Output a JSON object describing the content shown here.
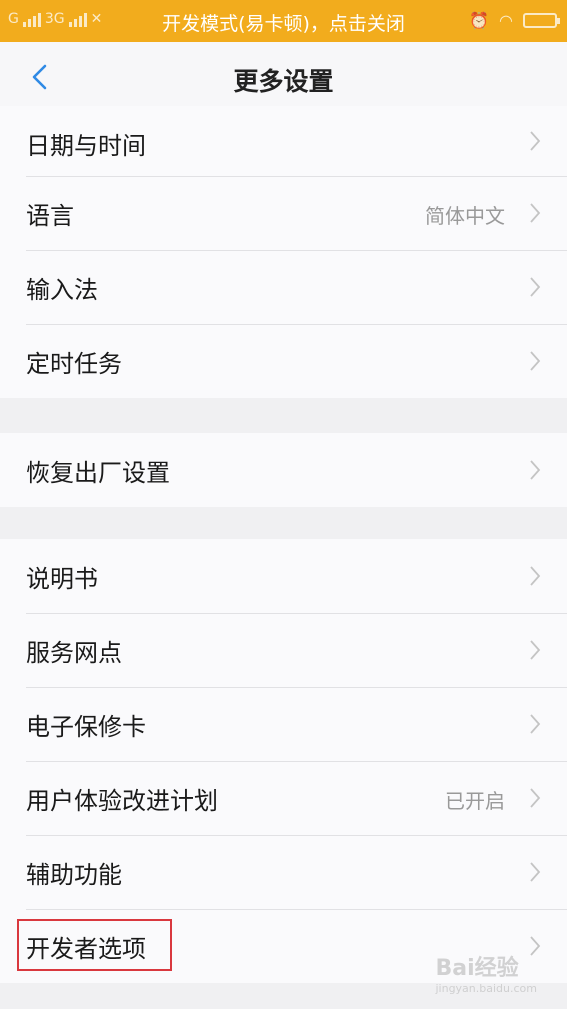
{
  "status_bar": {
    "left_text": "G",
    "network_label": "3G",
    "notice": "开发模式(易卡顿)，点击关闭"
  },
  "nav": {
    "title": "更多设置"
  },
  "group1": [
    {
      "label": "日期与时间",
      "value": ""
    },
    {
      "label": "语言",
      "value": "简体中文"
    },
    {
      "label": "输入法",
      "value": ""
    },
    {
      "label": "定时任务",
      "value": ""
    }
  ],
  "group2": [
    {
      "label": "恢复出厂设置",
      "value": ""
    }
  ],
  "group3": [
    {
      "label": "说明书",
      "value": ""
    },
    {
      "label": "服务网点",
      "value": ""
    },
    {
      "label": "电子保修卡",
      "value": ""
    },
    {
      "label": "用户体验改进计划",
      "value": "已开启"
    },
    {
      "label": "辅助功能",
      "value": ""
    },
    {
      "label": "开发者选项",
      "value": ""
    }
  ],
  "watermark": {
    "text": "Bai经验",
    "sub": "jingyan.baidu.com"
  },
  "colors": {
    "status_bar": "#f2ac1d",
    "accent": "#2f8ae5",
    "highlight": "#d9383e"
  }
}
